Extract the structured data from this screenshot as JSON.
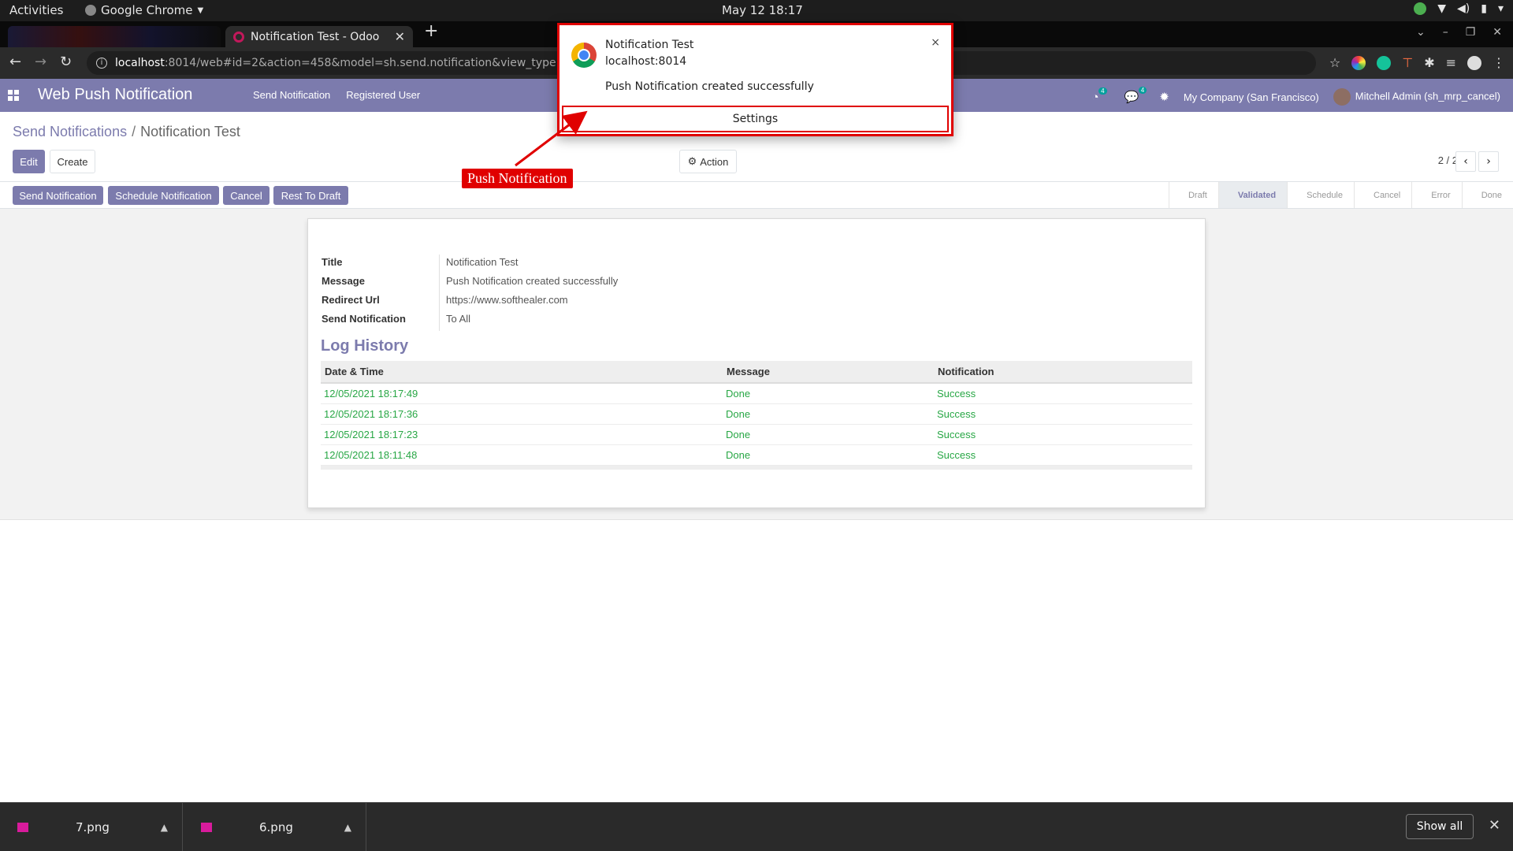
{
  "system_bar": {
    "activities": "Activities",
    "app_name": "Google Chrome",
    "clock": "May 12  18:17"
  },
  "browser": {
    "tab_title": "Notification Test - Odoo",
    "tab_close": "✕",
    "new_tab": "+",
    "url_host": "localhost",
    "url_rest": ":8014/web#id=2&action=458&model=sh.send.notification&view_type=form&cids=1&menu_id=325"
  },
  "odoo_nav": {
    "brand": "Web Push Notification",
    "menu": [
      "Send Notification",
      "Registered User"
    ],
    "activity_badge": "4",
    "chat_badge": "4",
    "company": "My Company (San Francisco)",
    "user": "Mitchell Admin (sh_mrp_cancel)"
  },
  "breadcrumb": {
    "parent": "Send Notifications",
    "separator": "/",
    "current": "Notification Test"
  },
  "control": {
    "edit": "Edit",
    "create": "Create",
    "action": "Action",
    "pager": "2 / 2",
    "prev": "‹",
    "next": "›"
  },
  "header_buttons": [
    "Send Notification",
    "Schedule Notification",
    "Cancel",
    "Rest To Draft"
  ],
  "status_steps": [
    "Draft",
    "Validated",
    "Schedule",
    "Cancel",
    "Error",
    "Done"
  ],
  "active_status": "Validated",
  "form": {
    "fields": [
      {
        "label": "Title",
        "value": "Notification Test"
      },
      {
        "label": "Message",
        "value": "Push Notification created successfully"
      },
      {
        "label": "Redirect Url",
        "value": "https://www.softhealer.com"
      },
      {
        "label": "Send Notification",
        "value": "To All"
      }
    ],
    "log_title": "Log History",
    "log_columns": [
      "Date & Time",
      "Message",
      "Notification"
    ],
    "log_rows": [
      [
        "12/05/2021 18:17:49",
        "Done",
        "Success"
      ],
      [
        "12/05/2021 18:17:36",
        "Done",
        "Success"
      ],
      [
        "12/05/2021 18:17:23",
        "Done",
        "Success"
      ],
      [
        "12/05/2021 18:11:48",
        "Done",
        "Success"
      ]
    ]
  },
  "notification": {
    "title": "Notification Test",
    "origin": "localhost:8014",
    "message": "Push Notification created successfully",
    "close": "×",
    "settings": "Settings"
  },
  "callout": "Push Notification",
  "downloads": {
    "items": [
      "7.png",
      "6.png"
    ],
    "show_all": "Show all",
    "close": "✕"
  },
  "colors": {
    "odoo_primary": "#7c7bad",
    "success_green": "#28a745",
    "highlight_red": "#e00000"
  }
}
